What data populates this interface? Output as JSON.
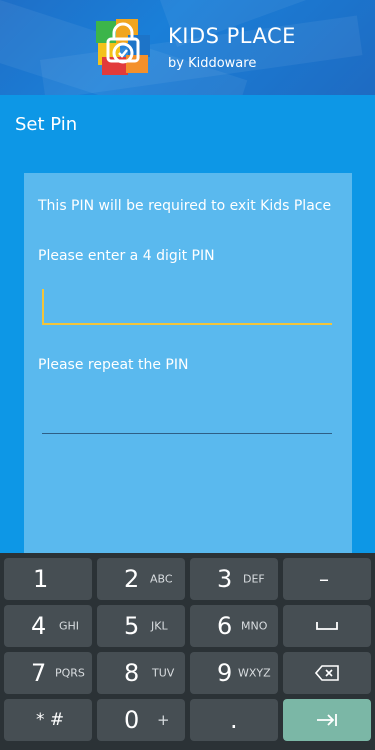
{
  "header": {
    "title": "KIDS PLACE",
    "subtitle": "by Kiddoware",
    "logo_icon": "kids-place-lock-logo"
  },
  "screen": {
    "title": "Set Pin"
  },
  "form": {
    "info_text": "This PIN will be required to exit Kids Place",
    "pin_label": "Please enter a 4 digit PIN",
    "pin_value": "",
    "repeat_label": "Please repeat the PIN",
    "repeat_value": ""
  },
  "keyboard": {
    "rows": [
      [
        {
          "main": "1",
          "sub": ""
        },
        {
          "main": "2",
          "sub": "ABC"
        },
        {
          "main": "3",
          "sub": "DEF"
        },
        {
          "main": "–",
          "sub": ""
        }
      ],
      [
        {
          "main": "4",
          "sub": "GHI"
        },
        {
          "main": "5",
          "sub": "JKL"
        },
        {
          "main": "6",
          "sub": "MNO"
        },
        {
          "main": "space-icon",
          "sub": ""
        }
      ],
      [
        {
          "main": "7",
          "sub": "PQRS"
        },
        {
          "main": "8",
          "sub": "TUV"
        },
        {
          "main": "9",
          "sub": "WXYZ"
        },
        {
          "main": "backspace-icon",
          "sub": ""
        }
      ],
      [
        {
          "main": "* #",
          "sub": ""
        },
        {
          "main": "0",
          "sub": "+"
        },
        {
          "main": ".",
          "sub": ""
        },
        {
          "main": "next-icon",
          "sub": ""
        }
      ]
    ]
  },
  "colors": {
    "page_bg": "#0d97e6",
    "card_bg": "#5ab9ee",
    "active_underline": "#f2c43a",
    "keyboard_bg": "#2b3236",
    "key_bg": "#464e53",
    "go_key_bg": "#7bb7a6"
  }
}
